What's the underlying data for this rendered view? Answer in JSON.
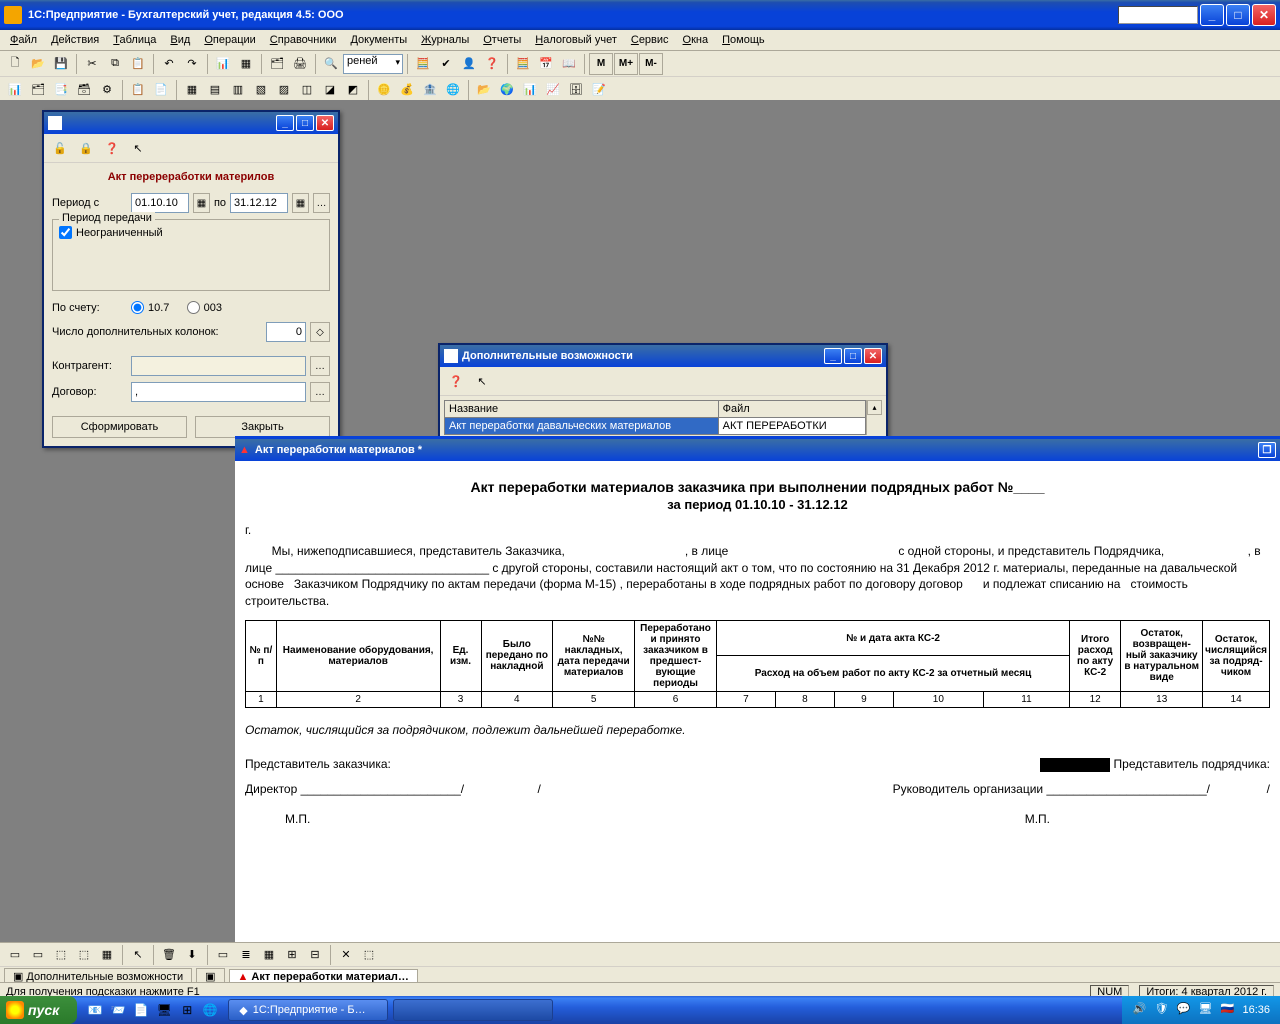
{
  "title": "1С:Предприятие - Бухгалтерский учет, редакция 4.5: ООО",
  "menu": [
    "Файл",
    "Действия",
    "Таблица",
    "Вид",
    "Операции",
    "Справочники",
    "Документы",
    "Журналы",
    "Отчеты",
    "Налоговый учет",
    "Сервис",
    "Окна",
    "Помощь"
  ],
  "toolbar1_dropdown": "реней",
  "m_buttons": [
    "М",
    "М+",
    "М-"
  ],
  "form": {
    "title": "Акт перереработки материлов",
    "period_label": "Период с",
    "date_from": "01.10.10",
    "date_to_label": "по",
    "date_to": "31.12.12",
    "group_title": "Период передачи",
    "unlimited": "Неограниченный",
    "by_account": "По счету:",
    "acc_opt1": "10.7",
    "acc_opt2": "003",
    "extra_cols": "Число дополнительных колонок:",
    "extra_cols_val": "0",
    "counterparty": "Контрагент:",
    "contract": "Договор:",
    "contract_val": ",",
    "btn_generate": "Сформировать",
    "btn_close": "Закрыть"
  },
  "features": {
    "title": "Дополнительные  возможности",
    "col_name": "Название",
    "col_file": "Файл",
    "row1_name": "Акт переработки давальческих материалов",
    "row1_file": "АКТ ПЕРЕРАБОТКИ"
  },
  "doc": {
    "wintitle": "Акт переработки материалов  *",
    "h1": "Акт переработки материалов заказчика при выполнении подрядных работ №____",
    "h2": "за период 01.10.10 - 31.12.12",
    "g": "г.",
    "body": "        Мы, нижеподписавшиеся, представитель Заказчика,                                    , в лице                                                   с одной стороны, и представитель Подрядчика,                         , в лице ________________________________ с другой стороны, составили настоящий акт о том, что по состоянию на 31 Декабря 2012 г. материалы, переданные на давальческой основе   Заказчиком Подрядчику по актам передачи (форма М-15) , переработаны в ходе подрядных работ по договору договор      и подлежат списанию на   стоимость строительства.",
    "headers": {
      "c1": "№ п/п",
      "c2": "Наименование оборудования, материалов",
      "c3": "Ед. изм.",
      "c4": "Было передано по накладной",
      "c5": "№№ накладных, дата передачи материалов",
      "c6": "Переработано и принято заказчиком в предшест-вующие периоды",
      "c7": "№ и дата акта  КС-2",
      "c7a": "Расход на объем работ по акту  КС-2 за отчетный месяц",
      "c12": "Итого расход по акту КС-2",
      "c13": "Остаток, возвращен-ный заказчику в натуральном виде",
      "c14": "Остаток, числящийся за подряд-чиком"
    },
    "nums": [
      "1",
      "2",
      "3",
      "4",
      "5",
      "6",
      "7",
      "8",
      "9",
      "10",
      "11",
      "12",
      "13",
      "14"
    ],
    "note": "Остаток, числящийся за подрядчиком, подлежит дальнейшей переработке.",
    "sig_cust": "Представитель заказчика:",
    "sig_cont": "Представитель подрядчика:",
    "director": "Директор ________________________/",
    "slash": "/",
    "head": "Руководитель организации ________________________/",
    "stamp": "М.П."
  },
  "tabs": {
    "t1": "Дополнительные возможности",
    "t3": "Акт переработки материал…"
  },
  "status": {
    "hint": "Для получения подсказки нажмите F1",
    "num": "NUM",
    "period": "Итоги: 4 квартал 2012 г."
  },
  "taskbar": {
    "start": "пуск",
    "app": "1С:Предприятие - Б…",
    "time": "16:36"
  }
}
